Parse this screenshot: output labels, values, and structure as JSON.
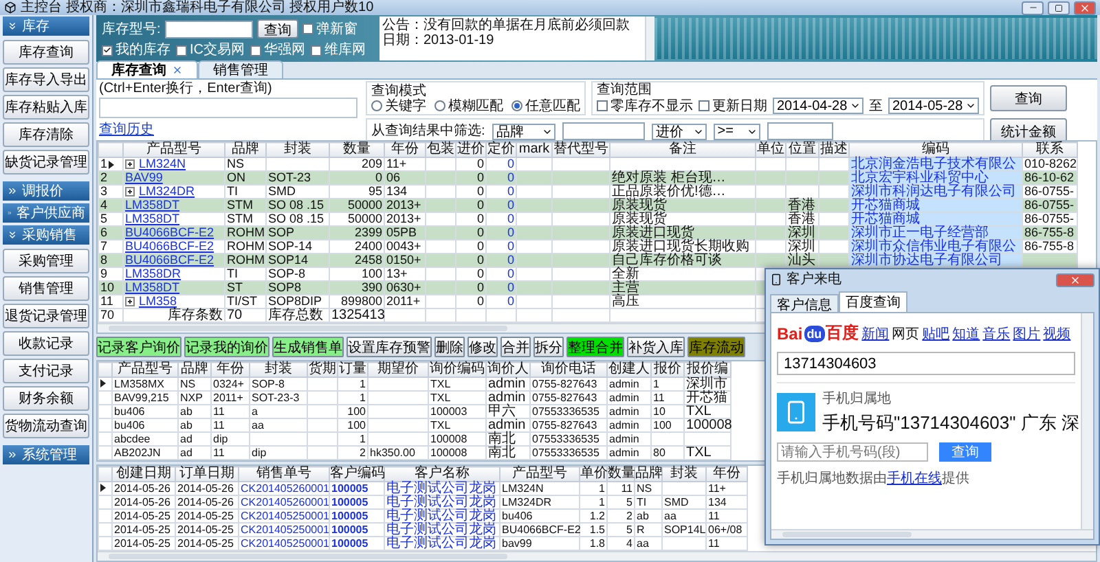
{
  "window": {
    "title": "主控台 授权商：深圳市鑫瑞科电子有限公司 授权用户数10"
  },
  "sidebar": [
    {
      "label": "库存",
      "expanded": true,
      "items": [
        "库存查询",
        "库存导入导出",
        "库存粘贴入库",
        "库存清除",
        "缺货记录管理"
      ]
    },
    {
      "label": "调报价",
      "expanded": false
    },
    {
      "label": "客户供应商",
      "expanded": false
    },
    {
      "label": "采购销售",
      "expanded": true,
      "items": [
        "采购管理",
        "销售管理",
        "退货记录管理",
        "收款记录",
        "支付记录",
        "财务余额",
        "货物流动查询"
      ]
    },
    {
      "label": "系统管理",
      "expanded": false
    }
  ],
  "header": {
    "model_label": "库存型号:",
    "search_button": "查询",
    "popup_option": {
      "label": "弹新窗",
      "checked": false
    },
    "sources": [
      {
        "label": "我的库存",
        "checked": true
      },
      {
        "label": "IC交易网",
        "checked": false
      },
      {
        "label": "华强网",
        "checked": false
      },
      {
        "label": "维库网",
        "checked": false
      }
    ],
    "notice": [
      "公告：没有回款的单据在月底前必须回款",
      "日期：2013-01-19"
    ]
  },
  "tabs": [
    {
      "label": "库存查询",
      "selected": true,
      "closable": true
    },
    {
      "label": "销售管理",
      "selected": false,
      "closable": false
    }
  ],
  "query": {
    "hint": "(Ctrl+Enter换行，Enter查询)",
    "history_link": "查询历史",
    "mode_title": "查询模式",
    "modes": [
      {
        "label": "关键字",
        "selected": false
      },
      {
        "label": "模糊匹配",
        "selected": false
      },
      {
        "label": "任意匹配",
        "selected": true
      }
    ],
    "range_title": "查询范围",
    "hide_zero": {
      "label": "零库存不显示",
      "checked": false
    },
    "update_date": {
      "label": "更新日期",
      "checked": false
    },
    "date_from": "2014-04-28",
    "date_to_label": "至",
    "date_to": "2014-05-28",
    "search_button": "查询",
    "filter_label": "从查询结果中筛选:",
    "filter_field": "品牌",
    "filter_price": "进价",
    "filter_operator": ">=",
    "sum_button": "统计金额"
  },
  "stock_table": {
    "columns": [
      {
        "label": "产品型号",
        "kind": "link"
      },
      {
        "label": "品牌",
        "kind": "text"
      },
      {
        "label": "封装",
        "kind": "text"
      },
      {
        "label": "数量",
        "kind": "num"
      },
      {
        "label": "年份",
        "kind": "text"
      },
      {
        "label": "包装",
        "kind": "text"
      },
      {
        "label": "进价",
        "kind": "num"
      },
      {
        "label": "定价",
        "kind": "price"
      },
      {
        "label": "mark",
        "kind": "text"
      },
      {
        "label": "替代型号",
        "kind": "text"
      },
      {
        "label": "备注",
        "kind": "cjk"
      },
      {
        "label": "单位",
        "kind": "cjk"
      },
      {
        "label": "位置",
        "kind": "cjk"
      },
      {
        "label": "描述",
        "kind": "cjk"
      },
      {
        "label": "编码",
        "kind": "company"
      },
      {
        "label": "联系",
        "kind": "text"
      }
    ],
    "rows": [
      {
        "kind": "item",
        "number": "1",
        "current": true,
        "expandable": true,
        "model": "LM324N",
        "brand": "NS",
        "qty": "209",
        "year": "11+",
        "cost": "0",
        "price": "0",
        "code": "北京润金浩电子技术有限公",
        "contact": "010-8262"
      },
      {
        "kind": "item",
        "number": "2",
        "current": false,
        "expandable": false,
        "model": "BAV99",
        "brand": "ON",
        "package": "SOT-23",
        "qty": "0",
        "year": "06",
        "cost": "0",
        "price": "0",
        "remark": "绝对原装 柜台现…",
        "code": "北京宏宇科业科贸中心",
        "contact": "86-10-62"
      },
      {
        "kind": "item",
        "number": "3",
        "current": false,
        "expandable": true,
        "model": "LM324DR",
        "brand": "TI",
        "package": "SMD",
        "qty": "95",
        "year": "134",
        "cost": "0",
        "price": "0",
        "remark": "正品原装价优!德…",
        "code": "深圳市科润达电子有限公司",
        "contact": "86-0755-"
      },
      {
        "kind": "item",
        "number": "4",
        "current": false,
        "expandable": false,
        "model": "LM358DT",
        "brand": "STM",
        "package": "SO 08 .15",
        "qty": "50000",
        "year": "2013+",
        "cost": "0",
        "price": "0",
        "remark": "原装现货",
        "location": "香港",
        "code": "开芯猫商城",
        "contact": "86-0755-"
      },
      {
        "kind": "item",
        "number": "5",
        "current": false,
        "expandable": false,
        "model": "LM358DT",
        "brand": "STM",
        "package": "SO 08 .15",
        "qty": "50000",
        "year": "2013+",
        "cost": "0",
        "price": "0",
        "remark": "原装现货",
        "location": "香港",
        "code": "开芯猫商城",
        "contact": "86-0755-"
      },
      {
        "kind": "item",
        "number": "6",
        "current": false,
        "expandable": false,
        "model": "BU4066BCF-E2",
        "brand": "ROHM",
        "package": "SOP",
        "qty": "2399",
        "year": "05PB",
        "cost": "0",
        "price": "0",
        "remark": "原装进口现货",
        "location": "深圳",
        "code": "深圳市正一电子经营部",
        "contact": "86-755-8"
      },
      {
        "kind": "item",
        "number": "7",
        "current": false,
        "expandable": false,
        "model": "BU4066BCF-E2",
        "brand": "ROHM",
        "package": "SOP-14",
        "qty": "2400",
        "year": "0043+",
        "cost": "0",
        "price": "0",
        "remark": "原装进口现货长期收购",
        "location": "深圳",
        "code": "深圳市众信伟业电子有限公",
        "contact": "86-755-8"
      },
      {
        "kind": "item",
        "number": "8",
        "current": false,
        "expandable": false,
        "model": "BU4066BCF-E2",
        "brand": "ROHM",
        "package": "SOP14",
        "qty": "2458",
        "year": "0150+",
        "cost": "0",
        "price": "0",
        "remark": "自己库存价格可谈",
        "location": "汕头",
        "code": "深圳市协达电子有限公司"
      },
      {
        "kind": "item",
        "number": "9",
        "current": false,
        "expandable": false,
        "model": "LM358DR",
        "brand": "TI",
        "package": "SOP-8",
        "qty": "100",
        "year": "13+",
        "cost": "0",
        "price": "0",
        "remark": "全新"
      },
      {
        "kind": "item",
        "number": "10",
        "current": false,
        "expandable": false,
        "model": "LM358DT",
        "brand": "ST",
        "package": "SOP8",
        "qty": "390",
        "year": "0630+",
        "cost": "0",
        "price": "0",
        "remark": "主营"
      },
      {
        "kind": "item",
        "number": "11",
        "current": false,
        "expandable": true,
        "model": "LM358",
        "brand": "TI/ST",
        "package": "SOP8DIP",
        "qty": "899800",
        "year": "2011+",
        "cost": "0",
        "price": "0",
        "remark": "高压"
      },
      {
        "kind": "summary",
        "number": "70",
        "model": "库存条数",
        "brand": "70",
        "package": "库存总数",
        "qty": "1325413"
      }
    ]
  },
  "actions": [
    {
      "label": "记录客户询价",
      "color": "#88ee88"
    },
    {
      "label": "记录我的询价",
      "color": "#88ee88"
    },
    {
      "label": "生成销售单",
      "color": "#88ee88"
    },
    {
      "label": "设置库存预警"
    },
    {
      "label": "删除"
    },
    {
      "label": "修改"
    },
    {
      "label": "合并"
    },
    {
      "label": "拆分"
    },
    {
      "label": "整理合并",
      "color": "#00e000"
    },
    {
      "label": "补货入库"
    },
    {
      "label": "库存流动",
      "color": "#808000"
    }
  ],
  "inquiries": {
    "columns": [
      {
        "label": "产品型号",
        "kind": "text"
      },
      {
        "label": "品牌",
        "kind": "text"
      },
      {
        "label": "年份",
        "kind": "text"
      },
      {
        "label": "封装",
        "kind": "text"
      },
      {
        "label": "货期",
        "kind": "text"
      },
      {
        "label": "订量",
        "kind": "num"
      },
      {
        "label": "期望价",
        "kind": "text"
      },
      {
        "label": "询价编码",
        "kind": "text"
      },
      {
        "label": "询价人",
        "kind": "cjk"
      },
      {
        "label": "询价电话",
        "kind": "text"
      },
      {
        "label": "创建人",
        "kind": "text"
      },
      {
        "label": "报价",
        "kind": "text"
      },
      {
        "label": "报价编",
        "kind": "cjk"
      }
    ],
    "rows": [
      {
        "current": true,
        "model": "LM358MX",
        "brand": "NS",
        "year": "0324+",
        "package": "SOP-8",
        "quantity": "1",
        "inquiry_code": "TXL",
        "inquirer": "admin",
        "phone": "0755-827643",
        "creator": "admin",
        "quote": "1",
        "column_13": "深圳市"
      },
      {
        "current": false,
        "model": "BAV99,215",
        "brand": "NXP",
        "year": "2011+",
        "package": "SOT-23-3",
        "quantity": "1",
        "inquiry_code": "TXL",
        "inquirer": "admin",
        "phone": "0755-827643",
        "creator": "admin",
        "quote": "11",
        "column_13": "开芯猫"
      },
      {
        "current": false,
        "model": "bu406",
        "brand": "ab",
        "year": "11",
        "package": "a",
        "quantity": "100",
        "inquiry_code": "100003",
        "inquirer": "甲六",
        "phone": "07553336535",
        "creator": "admin",
        "quote": "10",
        "column_13": "TXL"
      },
      {
        "current": false,
        "model": "bu406",
        "brand": "ab",
        "year": "11",
        "package": "aa",
        "quantity": "100",
        "inquiry_code": "TXL",
        "inquirer": "admin",
        "phone": "0755-827643",
        "creator": "admin",
        "quote": "100",
        "column_13": "100008"
      },
      {
        "current": false,
        "model": "abcdee",
        "brand": "ad",
        "year": "dip",
        "quantity": "1",
        "inquiry_code": "100008",
        "inquirer": "南北",
        "phone": "07553336535",
        "creator": "admin"
      },
      {
        "current": false,
        "model": "AB202JN",
        "brand": "ad",
        "year": "11",
        "package": "dip",
        "quantity": "2",
        "target_price": "hk350.00",
        "inquiry_code": "100008",
        "inquirer": "南北",
        "phone": "07553336535",
        "creator": "admin",
        "quote": "80",
        "column_13": "TXL"
      }
    ]
  },
  "orders": {
    "columns": [
      {
        "label": "创建日期",
        "kind": "text"
      },
      {
        "label": "订单日期",
        "kind": "text"
      },
      {
        "label": "销售单号",
        "kind": "order_no"
      },
      {
        "label": "客户编码",
        "kind": "code"
      },
      {
        "label": "客户名称",
        "kind": "customer"
      },
      {
        "label": "产品型号",
        "kind": "text"
      },
      {
        "label": "单价",
        "kind": "num"
      },
      {
        "label": "数量",
        "kind": "num"
      },
      {
        "label": "品牌",
        "kind": "text"
      },
      {
        "label": "封装",
        "kind": "text"
      },
      {
        "label": "年份",
        "kind": "text"
      }
    ],
    "rows": [
      {
        "current": true,
        "created": "2014-05-26",
        "order_date": "2014-05-26",
        "order_no": "CK201405260001",
        "customer_code": "100005",
        "customer": "电子测试公司龙岗",
        "model": "LM324N",
        "unit_price": "1",
        "quantity": "11",
        "brand": "NS",
        "year": "11+"
      },
      {
        "current": false,
        "created": "2014-05-26",
        "order_date": "2014-05-26",
        "order_no": "CK201405260001",
        "customer_code": "100005",
        "customer": "电子测试公司龙岗",
        "model": "LM324DR",
        "unit_price": "1",
        "quantity": "5",
        "brand": "TI",
        "package": "SMD",
        "year": "134"
      },
      {
        "current": false,
        "created": "2014-05-25",
        "order_date": "2014-05-25",
        "order_no": "CK201405250001",
        "customer_code": "100005",
        "customer": "电子测试公司龙岗",
        "model": "bu406",
        "unit_price": "1.2",
        "quantity": "2",
        "brand": "ab",
        "package": "aa",
        "year": "11"
      },
      {
        "current": false,
        "created": "2014-05-25",
        "order_date": "2014-05-25",
        "order_no": "CK201405250001",
        "customer_code": "100005",
        "customer": "电子测试公司龙岗",
        "model": "BU4066BCF-E2",
        "unit_price": "1.5",
        "quantity": "5",
        "brand": "R",
        "package": "SOP14L",
        "year": "06+/08"
      },
      {
        "current": false,
        "created": "2014-05-25",
        "order_date": "2014-05-25",
        "order_no": "CK201405250001",
        "customer_code": "100005",
        "customer": "电子测试公司龙岗",
        "model": "bav99",
        "unit_price": "1.8",
        "quantity": "4",
        "brand": "aa",
        "year": "11"
      }
    ]
  },
  "popup": {
    "title": "客户来电",
    "tabs": [
      {
        "label": "客户信息",
        "selected": false
      },
      {
        "label": "百度查询",
        "selected": true
      }
    ],
    "logo": {
      "latin": "Bai",
      "badge": "du",
      "chinese": "百度"
    },
    "nav": [
      {
        "label": "新闻",
        "selected": false
      },
      {
        "label": "网页",
        "selected": true
      },
      {
        "label": "贴吧",
        "selected": false
      },
      {
        "label": "知道",
        "selected": false
      },
      {
        "label": "音乐",
        "selected": false
      },
      {
        "label": "图片",
        "selected": false
      },
      {
        "label": "视频",
        "selected": false
      }
    ],
    "search_value": "13714304603",
    "result_title": "手机归属地",
    "result_text": "手机号码\"13714304603\" 广东 深",
    "lookup_placeholder": "请输入手机号码(段)",
    "lookup_button": "查询",
    "source_note": {
      "before": "手机归属地数据由",
      "link": "手机在线",
      "after": "提供"
    }
  }
}
